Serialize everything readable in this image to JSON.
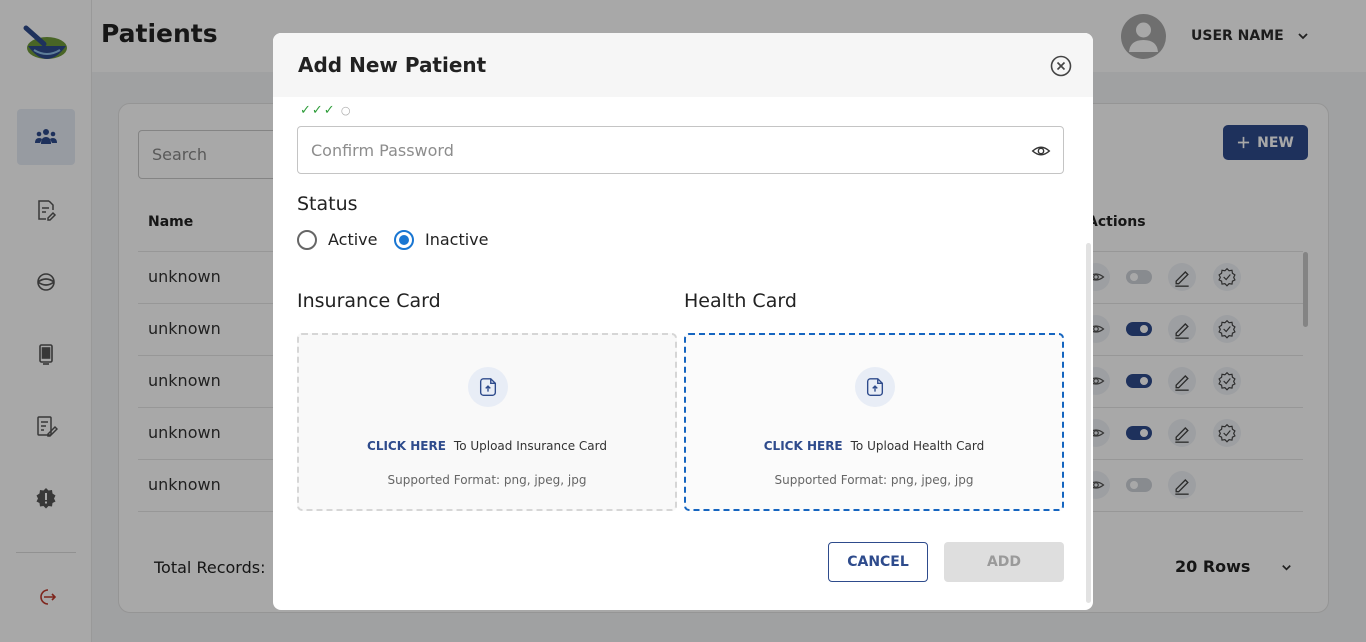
{
  "app": {
    "page_title": "Patients",
    "user_name": "USER NAME"
  },
  "sidebar": {
    "items": [
      {
        "icon": "patients-icon",
        "active": true
      },
      {
        "icon": "document-edit-icon",
        "active": false
      },
      {
        "icon": "ball-icon",
        "active": false
      },
      {
        "icon": "device-icon",
        "active": false
      },
      {
        "icon": "notes-edit-icon",
        "active": false
      },
      {
        "icon": "alert-badge-icon",
        "active": false
      },
      {
        "icon": "logout-icon",
        "active": false
      }
    ]
  },
  "table": {
    "search_placeholder": "Search",
    "new_button_label": "NEW",
    "col_name": "Name",
    "col_actions": "Actions",
    "rows": [
      {
        "name": "unknown",
        "active": false,
        "verified": true
      },
      {
        "name": "unknown",
        "active": true,
        "verified": true
      },
      {
        "name": "unknown",
        "active": true,
        "verified": true
      },
      {
        "name": "unknown",
        "active": true,
        "verified": true
      },
      {
        "name": "unknown",
        "active": false,
        "verified": false
      }
    ],
    "total_records_label": "Total Records:",
    "rows_per_page": "20 Rows"
  },
  "modal": {
    "title": "Add New Patient",
    "password_strength": "✓✓✓",
    "password_strength_empty": "○",
    "confirm_password_placeholder": "Confirm Password",
    "status_label": "Status",
    "status_options": [
      "Active",
      "Inactive"
    ],
    "status_selected": "Inactive",
    "insurance": {
      "title": "Insurance Card",
      "click_here": "CLICK HERE",
      "upload_text": "To Upload Insurance Card",
      "format": "Supported Format: png, jpeg, jpg"
    },
    "health": {
      "title": "Health Card",
      "click_here": "CLICK HERE",
      "upload_text": "To Upload Health Card",
      "format": "Supported Format: png, jpeg, jpg"
    },
    "cancel_label": "CANCEL",
    "add_label": "ADD"
  },
  "colors": {
    "primary": "#2e4b8c",
    "radio_selected": "#1976d2",
    "focus_border": "#1565c0",
    "check_green": "#2e9d3a"
  }
}
